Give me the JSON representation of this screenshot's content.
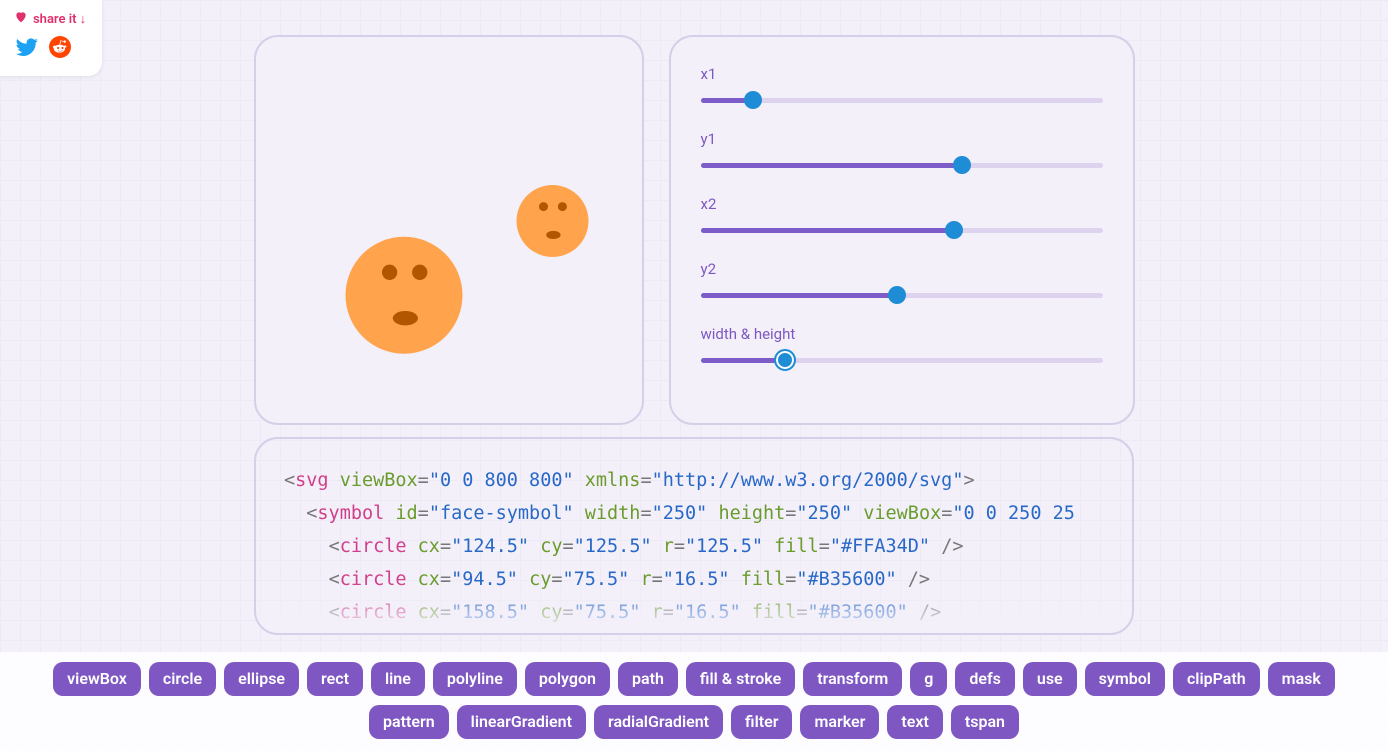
{
  "share": {
    "label": "share it ↓",
    "icons": [
      "heart",
      "twitter",
      "reddit"
    ]
  },
  "sliders": [
    {
      "label": "x1",
      "fillPercent": 13,
      "thumbPercent": 13,
      "selected": false
    },
    {
      "label": "y1",
      "fillPercent": 65,
      "thumbPercent": 65,
      "selected": false
    },
    {
      "label": "x2",
      "fillPercent": 63,
      "thumbPercent": 63,
      "selected": false
    },
    {
      "label": "y2",
      "fillPercent": 49,
      "thumbPercent": 49,
      "selected": false
    },
    {
      "label": "width & height",
      "fillPercent": 21,
      "thumbPercent": 21,
      "selected": true
    }
  ],
  "code": {
    "lines": [
      {
        "indent": 0,
        "parts": [
          {
            "c": "t-bracket",
            "t": "<"
          },
          {
            "c": "t-tag",
            "t": "svg"
          },
          {
            "c": "",
            "t": " "
          },
          {
            "c": "t-attr",
            "t": "viewBox"
          },
          {
            "c": "t-eq",
            "t": "="
          },
          {
            "c": "t-val",
            "t": "\"0 0 800 800\""
          },
          {
            "c": "",
            "t": " "
          },
          {
            "c": "t-attr",
            "t": "xmlns"
          },
          {
            "c": "t-eq",
            "t": "="
          },
          {
            "c": "t-val",
            "t": "\"http://www.w3.org/2000/svg\""
          },
          {
            "c": "t-bracket",
            "t": ">"
          }
        ]
      },
      {
        "indent": 1,
        "parts": [
          {
            "c": "t-bracket",
            "t": "<"
          },
          {
            "c": "t-tag",
            "t": "symbol"
          },
          {
            "c": "",
            "t": " "
          },
          {
            "c": "t-attr",
            "t": "id"
          },
          {
            "c": "t-eq",
            "t": "="
          },
          {
            "c": "t-val",
            "t": "\"face-symbol\""
          },
          {
            "c": "",
            "t": " "
          },
          {
            "c": "t-attr",
            "t": "width"
          },
          {
            "c": "t-eq",
            "t": "="
          },
          {
            "c": "t-val",
            "t": "\"250\""
          },
          {
            "c": "",
            "t": " "
          },
          {
            "c": "t-attr",
            "t": "height"
          },
          {
            "c": "t-eq",
            "t": "="
          },
          {
            "c": "t-val",
            "t": "\"250\""
          },
          {
            "c": "",
            "t": " "
          },
          {
            "c": "t-attr",
            "t": "viewBox"
          },
          {
            "c": "t-eq",
            "t": "="
          },
          {
            "c": "t-val",
            "t": "\"0 0 250 25"
          }
        ]
      },
      {
        "indent": 2,
        "parts": [
          {
            "c": "t-bracket",
            "t": "<"
          },
          {
            "c": "t-tag",
            "t": "circle"
          },
          {
            "c": "",
            "t": " "
          },
          {
            "c": "t-attr",
            "t": "cx"
          },
          {
            "c": "t-eq",
            "t": "="
          },
          {
            "c": "t-val",
            "t": "\"124.5\""
          },
          {
            "c": "",
            "t": " "
          },
          {
            "c": "t-attr",
            "t": "cy"
          },
          {
            "c": "t-eq",
            "t": "="
          },
          {
            "c": "t-val",
            "t": "\"125.5\""
          },
          {
            "c": "",
            "t": " "
          },
          {
            "c": "t-attr",
            "t": "r"
          },
          {
            "c": "t-eq",
            "t": "="
          },
          {
            "c": "t-val",
            "t": "\"125.5\""
          },
          {
            "c": "",
            "t": " "
          },
          {
            "c": "t-attr",
            "t": "fill"
          },
          {
            "c": "t-eq",
            "t": "="
          },
          {
            "c": "t-val",
            "t": "\"#FFA34D\""
          },
          {
            "c": "",
            "t": " "
          },
          {
            "c": "t-bracket",
            "t": "/>"
          }
        ]
      },
      {
        "indent": 2,
        "parts": [
          {
            "c": "t-bracket",
            "t": "<"
          },
          {
            "c": "t-tag",
            "t": "circle"
          },
          {
            "c": "",
            "t": " "
          },
          {
            "c": "t-attr",
            "t": "cx"
          },
          {
            "c": "t-eq",
            "t": "="
          },
          {
            "c": "t-val",
            "t": "\"94.5\""
          },
          {
            "c": "",
            "t": " "
          },
          {
            "c": "t-attr",
            "t": "cy"
          },
          {
            "c": "t-eq",
            "t": "="
          },
          {
            "c": "t-val",
            "t": "\"75.5\""
          },
          {
            "c": "",
            "t": " "
          },
          {
            "c": "t-attr",
            "t": "r"
          },
          {
            "c": "t-eq",
            "t": "="
          },
          {
            "c": "t-val",
            "t": "\"16.5\""
          },
          {
            "c": "",
            "t": " "
          },
          {
            "c": "t-attr",
            "t": "fill"
          },
          {
            "c": "t-eq",
            "t": "="
          },
          {
            "c": "t-val",
            "t": "\"#B35600\""
          },
          {
            "c": "",
            "t": " "
          },
          {
            "c": "t-bracket",
            "t": "/>"
          }
        ]
      },
      {
        "indent": 2,
        "parts": [
          {
            "c": "t-bracket",
            "t": "<"
          },
          {
            "c": "t-tag",
            "t": "circle"
          },
          {
            "c": "",
            "t": " "
          },
          {
            "c": "t-attr",
            "t": "cx"
          },
          {
            "c": "t-eq",
            "t": "="
          },
          {
            "c": "t-val",
            "t": "\"158.5\""
          },
          {
            "c": "",
            "t": " "
          },
          {
            "c": "t-attr",
            "t": "cy"
          },
          {
            "c": "t-eq",
            "t": "="
          },
          {
            "c": "t-val",
            "t": "\"75.5\""
          },
          {
            "c": "",
            "t": " "
          },
          {
            "c": "t-attr",
            "t": "r"
          },
          {
            "c": "t-eq",
            "t": "="
          },
          {
            "c": "t-val",
            "t": "\"16.5\""
          },
          {
            "c": "",
            "t": " "
          },
          {
            "c": "t-attr",
            "t": "fill"
          },
          {
            "c": "t-eq",
            "t": "="
          },
          {
            "c": "t-val",
            "t": "\"#B35600\""
          },
          {
            "c": "",
            "t": " "
          },
          {
            "c": "t-bracket",
            "t": "/>"
          }
        ]
      }
    ]
  },
  "tags": [
    "viewBox",
    "circle",
    "ellipse",
    "rect",
    "line",
    "polyline",
    "polygon",
    "path",
    "fill & stroke",
    "transform",
    "g",
    "defs",
    "use",
    "symbol",
    "clipPath",
    "mask",
    "pattern",
    "linearGradient",
    "radialGradient",
    "filter",
    "marker",
    "text",
    "tspan"
  ],
  "preview": {
    "face_fill": "#FFA34D",
    "feature_fill": "#B35600"
  }
}
